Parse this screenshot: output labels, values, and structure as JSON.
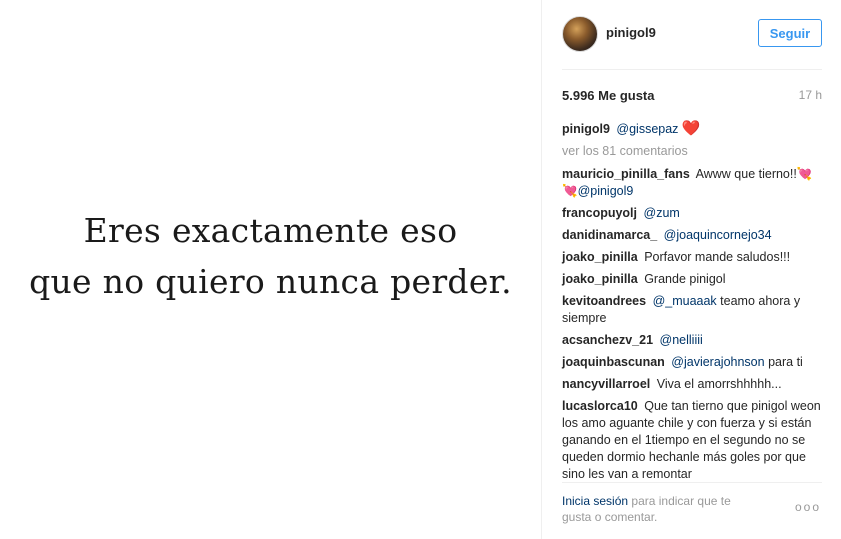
{
  "post": {
    "quote_line1": "Eres exactamente eso",
    "quote_line2": "que no quiero nunca perder."
  },
  "header": {
    "username": "pinigol9",
    "follow_label": "Seguir"
  },
  "stats": {
    "likes": "5.996 Me gusta",
    "time": "17 h"
  },
  "caption": {
    "user": "pinigol9",
    "mention": "@gissepaz",
    "emoji": "❤️"
  },
  "view_all": "ver los 81 comentarios",
  "comments": [
    {
      "user": "mauricio_pinilla_fans",
      "text": "Awww que tierno!!💘",
      "mention": "💘@pinigol9",
      "after": ""
    },
    {
      "user": "francopuyolj",
      "text": "",
      "mention": "@zum",
      "after": ""
    },
    {
      "user": "danidinamarca_",
      "text": "",
      "mention": "@joaquincornejo34",
      "after": ""
    },
    {
      "user": "joako_pinilla",
      "text": "Porfavor mande saludos!!!",
      "mention": "",
      "after": ""
    },
    {
      "user": "joako_pinilla",
      "text": "Grande pinigol",
      "mention": "",
      "after": ""
    },
    {
      "user": "kevitoandrees",
      "text": "",
      "mention": "@_muaaak",
      "after": "teamo ahora y siempre"
    },
    {
      "user": "acsanchezv_21",
      "text": "",
      "mention": "@nelliiii",
      "after": ""
    },
    {
      "user": "joaquinbascunan",
      "text": "",
      "mention": "@javierajohnson",
      "after": "para ti"
    },
    {
      "user": "nancyvillarroel",
      "text": "Viva el amorrshhhhh...",
      "mention": "",
      "after": ""
    },
    {
      "user": "lucaslorca10",
      "text": "Que tan tierno que pinigol weon los amo aguante chile y con fuerza y si están ganando en el 1tiempo en el segundo no se queden dormio hechanle más goles por que sino les van a remontar",
      "mention": "",
      "after": ""
    }
  ],
  "footer": {
    "login": "Inicia sesión",
    "rest": "para indicar que te gusta o comentar.",
    "more": "ooo"
  }
}
